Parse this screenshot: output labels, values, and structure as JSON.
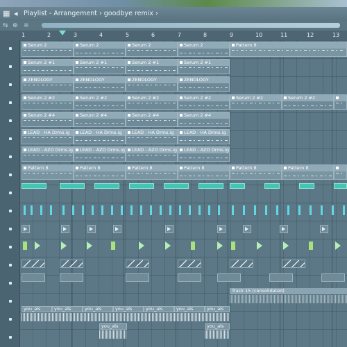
{
  "window": {
    "title": "Playlist - Arrangement › goodbye remix ›"
  },
  "ruler": {
    "bars": [
      "1",
      "2",
      "3",
      "4",
      "5",
      "6",
      "7",
      "8",
      "9",
      "10",
      "11",
      "12",
      "13"
    ]
  },
  "tracks": {
    "serum2": "Serum 2",
    "serum2_1": "Serum 2 #1",
    "zenology": "ZENOLOGY",
    "serum2_2": "Serum 2 #2",
    "serum2_4": "Serum 2 #4",
    "lead_ha": "LEAD - HA  Drms.ig",
    "lead_azo": "LEAD - AZO  Drms.ig",
    "pattern8": "Pattern 8",
    "pattern9": "Pattern 9",
    "track15": "Track 15 (consolidated)",
    "you_als": "you_als"
  },
  "colors": {
    "clip": "#6e8a98",
    "teal": "#44c4b4",
    "cyan": "#62d8e6",
    "green": "#a7e27c",
    "background": "#55707e"
  }
}
